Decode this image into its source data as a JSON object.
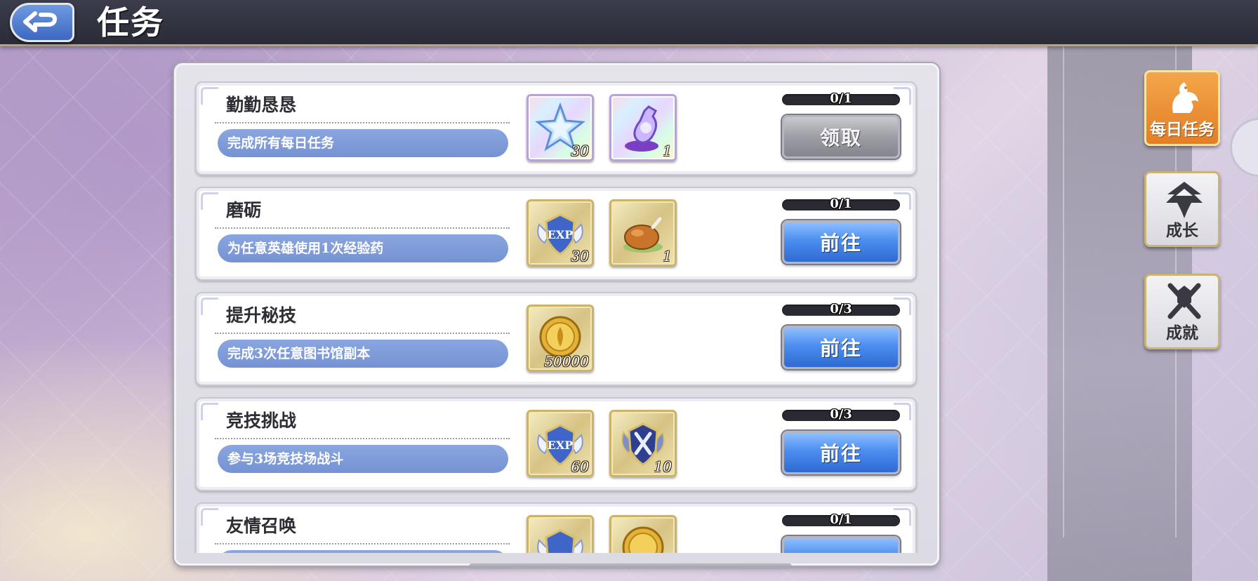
{
  "header": {
    "title": "任务"
  },
  "tasks": [
    {
      "title": "勤勤恳恳",
      "description": "完成所有每日任务",
      "rewards": [
        {
          "icon": "crystal-star-icon",
          "qty": "30",
          "frame": "rainbow"
        },
        {
          "icon": "potion-bottle-icon",
          "qty": "1",
          "frame": "rainbow"
        }
      ],
      "progress_text": "0/1",
      "progress_value": 0,
      "button_label": "领取",
      "button_style": "grey"
    },
    {
      "title": "磨砺",
      "description": "为任意英雄使用1次经验药",
      "rewards": [
        {
          "icon": "exp-shield-icon",
          "qty": "30",
          "frame": "gold"
        },
        {
          "icon": "roast-chicken-icon",
          "qty": "1",
          "frame": "gold"
        }
      ],
      "progress_text": "0/1",
      "progress_value": 0,
      "button_label": "前往",
      "button_style": "blue"
    },
    {
      "title": "提升秘技",
      "description": "完成3次任意图书馆副本",
      "rewards": [
        {
          "icon": "gold-coin-icon",
          "qty": "50000",
          "frame": "gold"
        }
      ],
      "progress_text": "0/3",
      "progress_value": 0,
      "button_label": "前往",
      "button_style": "blue"
    },
    {
      "title": "竞技挑战",
      "description": "参与3场竞技场战斗",
      "rewards": [
        {
          "icon": "exp-shield-icon",
          "qty": "60",
          "frame": "gold"
        },
        {
          "icon": "arena-swords-badge-icon",
          "qty": "10",
          "frame": "gold"
        }
      ],
      "progress_text": "0/3",
      "progress_value": 0,
      "button_label": "前往",
      "button_style": "blue"
    },
    {
      "title": "友情召唤",
      "description": "",
      "rewards": [
        {
          "icon": "exp-shield-icon",
          "qty": "",
          "frame": "gold"
        },
        {
          "icon": "gold-coin-icon",
          "qty": "",
          "frame": "gold"
        }
      ],
      "progress_text": "0/1",
      "progress_value": 0,
      "button_label": "",
      "button_style": "blue"
    }
  ],
  "side_tabs": [
    {
      "label": "每日任务",
      "icon": "daily-dragon-icon",
      "active": true
    },
    {
      "label": "成长",
      "icon": "growth-tree-icon",
      "active": false
    },
    {
      "label": "成就",
      "icon": "achievement-crossed-swords-icon",
      "active": false
    }
  ],
  "colors": {
    "accent_orange": "#e27e26",
    "button_blue": "#4c8ef0",
    "desc_pill": "#7b98d6"
  }
}
